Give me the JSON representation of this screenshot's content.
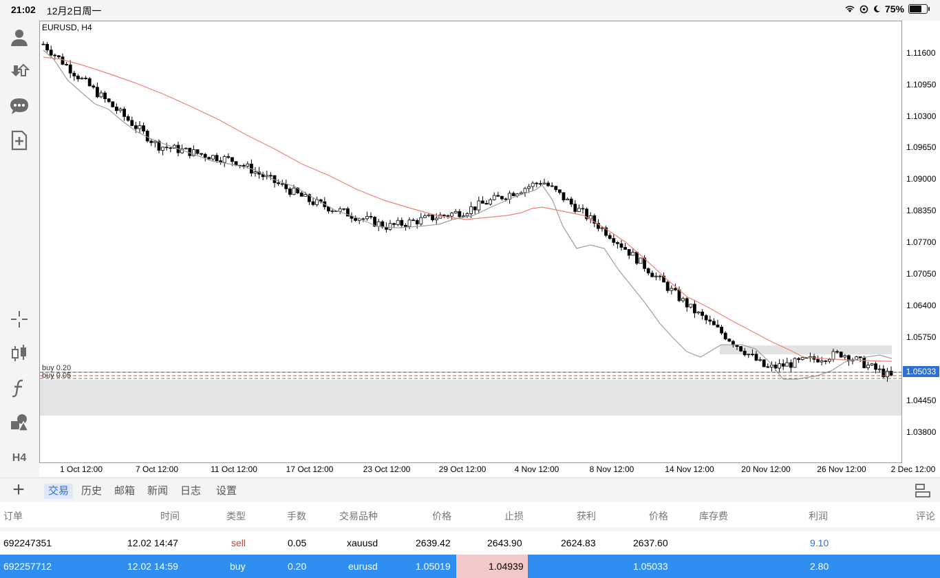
{
  "status_bar": {
    "time": "21:02",
    "date": "12月2日周一",
    "battery": "75%",
    "battery_level": 0.75
  },
  "toolbar": {
    "timeframe_label": "H4"
  },
  "chart": {
    "title": "EURUSD, H4",
    "current_price": "1.05033",
    "y_ticks": [
      "1.11600",
      "1.10950",
      "1.10300",
      "1.09650",
      "1.09000",
      "1.08350",
      "1.07700",
      "1.07050",
      "1.06400",
      "1.05750",
      "1.04450",
      "1.03800"
    ],
    "x_ticks": [
      "1 Oct 12:00",
      "7 Oct 12:00",
      "11 Oct 12:00",
      "17 Oct 12:00",
      "23 Oct 12:00",
      "29 Oct 12:00",
      "4 Nov 12:00",
      "8 Nov 12:00",
      "14 Nov 12:00",
      "20 Nov 12:00",
      "26 Nov 12:00",
      "2 Dec 12:00"
    ],
    "order_labels": [
      "buy 0.20",
      "buy 0.05"
    ],
    "colors": {
      "ma_fast": "#9e9e9e",
      "ma_slow": "#f08070",
      "price_label": "#2f6fd3"
    }
  },
  "chart_data": {
    "type": "line",
    "title": "EURUSD, H4",
    "xlabel": "",
    "ylabel": "",
    "x": [
      "1 Oct 12:00",
      "7 Oct 12:00",
      "11 Oct 12:00",
      "17 Oct 12:00",
      "23 Oct 12:00",
      "29 Oct 12:00",
      "4 Nov 12:00",
      "8 Nov 12:00",
      "14 Nov 12:00",
      "20 Nov 12:00",
      "26 Nov 12:00",
      "2 Dec 12:00"
    ],
    "ylim": [
      1.0335,
      1.1205
    ],
    "series": [
      {
        "values": [
          1.109,
          1.096,
          1.093,
          1.085,
          1.08,
          1.083,
          1.089,
          1.078,
          1.064,
          1.052,
          1.055,
          1.0503
        ]
      }
    ],
    "current_price": 1.05033
  },
  "tabs": [
    "交易",
    "历史",
    "邮箱",
    "新闻",
    "日志",
    "设置"
  ],
  "active_tab": "交易",
  "table": {
    "headers": [
      "订单",
      "时间",
      "类型",
      "手数",
      "交易品种",
      "价格",
      "止损",
      "获利",
      "价格",
      "库存费",
      "利润",
      "评论"
    ],
    "rows": [
      {
        "order": "692247351",
        "time": "12.02 14:47",
        "type": "sell",
        "lots": "0.05",
        "symbol": "xauusd",
        "price": "2639.42",
        "sl": "2643.90",
        "tp": "2624.83",
        "cur_price": "2637.60",
        "swap": "",
        "profit": "9.10",
        "comment": ""
      },
      {
        "order": "692257712",
        "time": "12.02 14:59",
        "type": "buy",
        "lots": "0.20",
        "symbol": "eurusd",
        "price": "1.05019",
        "sl": "1.04939",
        "tp": "",
        "cur_price": "1.05033",
        "swap": "",
        "profit": "2.80",
        "comment": ""
      }
    ]
  }
}
